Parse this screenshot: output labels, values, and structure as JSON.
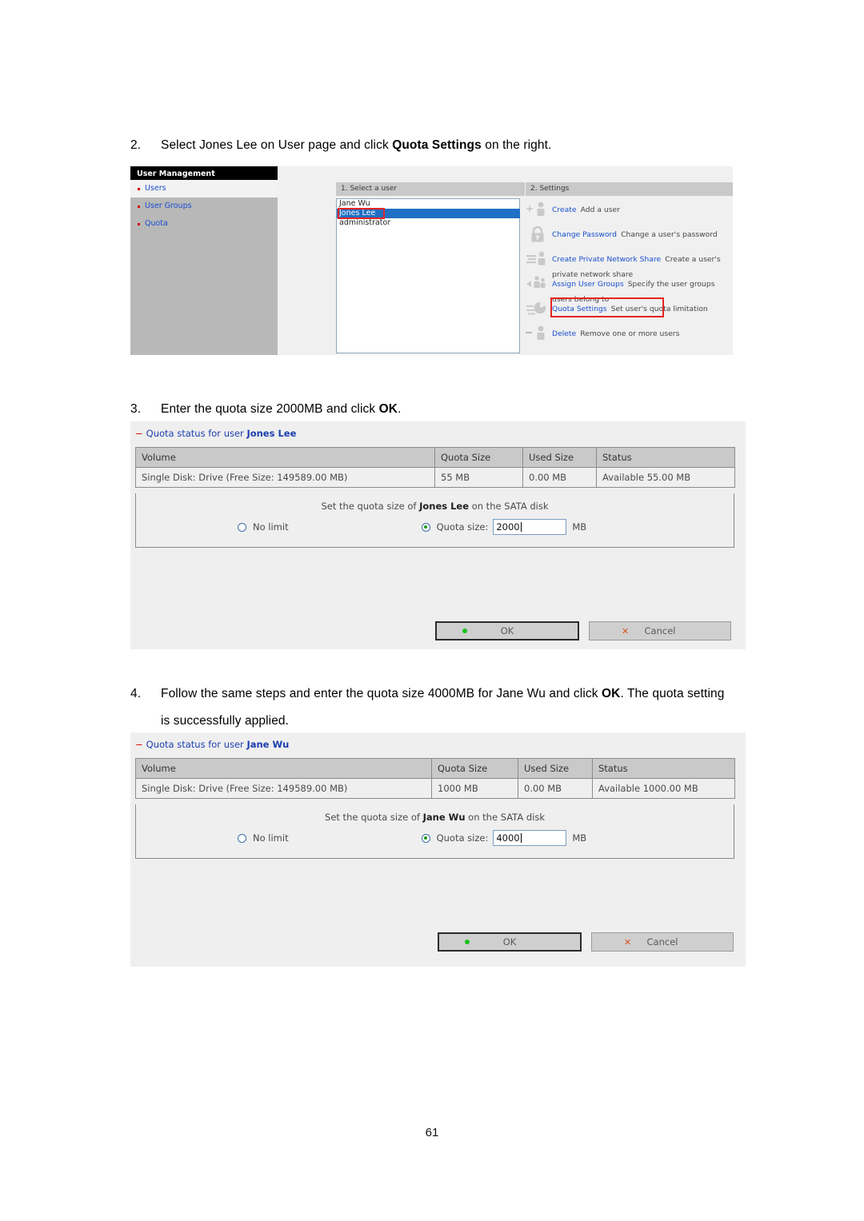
{
  "document": {
    "page_number": "61",
    "steps": [
      {
        "number": "2.",
        "text_before": "Select Jones Lee on User page and click ",
        "bold": "Quota Settings",
        "text_after": " on the right."
      },
      {
        "number": "3.",
        "text_before": "Enter the quota size 2000MB and click ",
        "bold": "OK",
        "text_after": "."
      },
      {
        "number": "4.",
        "text_before": "Follow the same steps and enter the quota size 4000MB for Jane Wu and click ",
        "bold": "OK",
        "text_after": ".  The quota setting is successfully applied."
      }
    ]
  },
  "user_management": {
    "sidebar": {
      "title": "User Management",
      "items": [
        {
          "label": "Users",
          "selected": true
        },
        {
          "label": "User Groups",
          "selected": false
        },
        {
          "label": "Quota",
          "selected": false
        }
      ]
    },
    "pane_headers": {
      "select_user": "1. Select a user",
      "settings": "2. Settings"
    },
    "users": [
      {
        "name": "Jane Wu",
        "selected": false
      },
      {
        "name": "Jones Lee",
        "selected": true
      },
      {
        "name": "administrator",
        "selected": false
      }
    ],
    "settings": [
      {
        "icon": "add-user-icon",
        "link": "Create",
        "desc": "Add a user"
      },
      {
        "icon": "lock-icon",
        "link": "Change Password",
        "desc": "Change a user's password"
      },
      {
        "icon": "network-share-icon",
        "link": "Create Private Network Share",
        "desc": "Create a user's private network share"
      },
      {
        "icon": "assign-groups-icon",
        "link": "Assign User Groups",
        "desc": "Specify the user groups users belong to"
      },
      {
        "icon": "quota-pie-icon",
        "link": "Quota Settings",
        "desc": "Set user's quota limitation",
        "highlighted": true
      },
      {
        "icon": "remove-user-icon",
        "link": "Delete",
        "desc": "Remove one or more users"
      }
    ]
  },
  "quota_jones": {
    "heading_prefix": "Quota status for user ",
    "heading_user": "Jones Lee",
    "columns": [
      "Volume",
      "Quota Size",
      "Used Size",
      "Status"
    ],
    "rows": [
      [
        "Single Disk: Drive (Free Size: 149589.00 MB)",
        "55 MB",
        "0.00 MB",
        "Available 55.00 MB"
      ]
    ],
    "set_label_before": "Set the quota size of ",
    "set_label_user": "Jones Lee",
    "set_label_after": " on the SATA disk",
    "no_limit_label": "No limit",
    "no_limit_selected": false,
    "quota_size_label": "Quota size:",
    "quota_size_selected": true,
    "quota_value": "2000",
    "unit": "MB",
    "ok_label": "OK",
    "cancel_label": "Cancel"
  },
  "quota_jane": {
    "heading_prefix": "Quota status for user ",
    "heading_user": "Jane Wu",
    "columns": [
      "Volume",
      "Quota Size",
      "Used Size",
      "Status"
    ],
    "rows": [
      [
        "Single Disk: Drive (Free Size: 149589.00 MB)",
        "1000 MB",
        "0.00 MB",
        "Available 1000.00 MB"
      ]
    ],
    "set_label_before": "Set the quota size of ",
    "set_label_user": "Jane Wu",
    "set_label_after": " on the SATA disk",
    "no_limit_label": "No limit",
    "no_limit_selected": false,
    "quota_size_label": "Quota size:",
    "quota_size_selected": true,
    "quota_value": "4000",
    "unit": "MB",
    "ok_label": "OK",
    "cancel_label": "Cancel"
  },
  "colors": {
    "link": "#1a4fcf",
    "highlight_box": "#e52421",
    "selection": "#1f6fc4",
    "ok_dot": "#19c219",
    "cancel_x": "#d8511d"
  }
}
